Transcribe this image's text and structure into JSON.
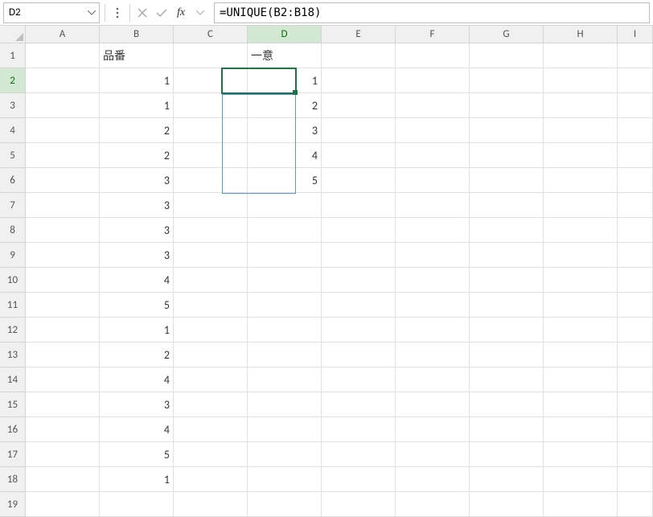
{
  "name_box": {
    "value": "D2"
  },
  "formula": {
    "value": "=UNIQUE(B2:B18)"
  },
  "columns": [
    "A",
    "B",
    "C",
    "D",
    "E",
    "F",
    "G",
    "H",
    "I"
  ],
  "active_col": "D",
  "active_row": "2",
  "rows": [
    "1",
    "2",
    "3",
    "4",
    "5",
    "6",
    "7",
    "8",
    "9",
    "10",
    "11",
    "12",
    "13",
    "14",
    "15",
    "16",
    "17",
    "18",
    "19"
  ],
  "headers": {
    "B1": "品番",
    "D1": "一意"
  },
  "col_b": [
    "1",
    "1",
    "2",
    "2",
    "3",
    "3",
    "3",
    "3",
    "4",
    "5",
    "1",
    "2",
    "4",
    "3",
    "4",
    "5",
    "1"
  ],
  "col_d": [
    "1",
    "2",
    "3",
    "4",
    "5"
  ],
  "chart_data": {
    "type": "table",
    "title": "Excel UNIQUE function spill range",
    "columns_visible": [
      "A",
      "B",
      "C",
      "D",
      "E",
      "F",
      "G",
      "H",
      "I"
    ],
    "data": {
      "B": {
        "header": "品番",
        "values": [
          1,
          1,
          2,
          2,
          3,
          3,
          3,
          3,
          4,
          5,
          1,
          2,
          4,
          3,
          4,
          5,
          1
        ]
      },
      "D": {
        "header": "一意",
        "values": [
          1,
          2,
          3,
          4,
          5
        ],
        "formula": "=UNIQUE(B2:B18)",
        "spill_origin": "D2"
      }
    },
    "selected_cell": "D2"
  }
}
